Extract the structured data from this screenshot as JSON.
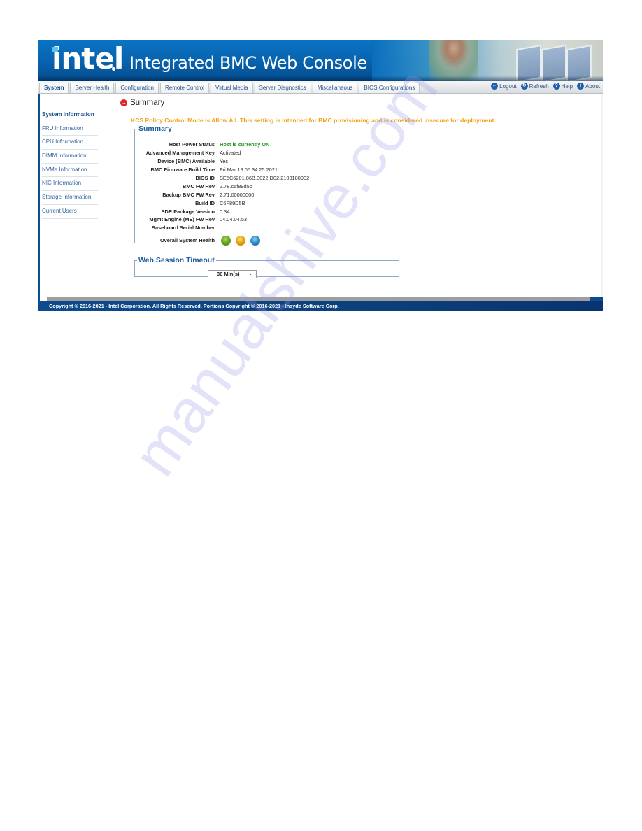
{
  "header": {
    "logo_text": "intel",
    "app_title": "Integrated BMC Web Console"
  },
  "tabs": [
    {
      "label": "System",
      "active": true
    },
    {
      "label": "Server Health",
      "active": false
    },
    {
      "label": "Configuration",
      "active": false
    },
    {
      "label": "Remote Control",
      "active": false
    },
    {
      "label": "Virtual Media",
      "active": false
    },
    {
      "label": "Server Diagnostics",
      "active": false
    },
    {
      "label": "Miscellaneous",
      "active": false
    },
    {
      "label": "BIOS Configurations",
      "active": false
    }
  ],
  "toolbar": {
    "logout": {
      "label": "Logout",
      "icon": "logout-icon",
      "glyph": "←"
    },
    "refresh": {
      "label": "Refresh",
      "icon": "refresh-icon",
      "glyph": "↻"
    },
    "help": {
      "label": "Help",
      "icon": "help-icon",
      "glyph": "?"
    },
    "about": {
      "label": "About",
      "icon": "info-icon",
      "glyph": "i"
    }
  },
  "sidebar": {
    "items": [
      {
        "label": "System Information",
        "active": true
      },
      {
        "label": "FRU Information",
        "active": false
      },
      {
        "label": "CPU Information",
        "active": false
      },
      {
        "label": "DIMM Information",
        "active": false
      },
      {
        "label": "NVMe Information",
        "active": false
      },
      {
        "label": "NIC Information",
        "active": false
      },
      {
        "label": "Storage Information",
        "active": false
      },
      {
        "label": "Current Users",
        "active": false
      }
    ]
  },
  "main": {
    "page_title": "Summary",
    "page_icon_glyph": "→",
    "warning": "KCS Policy Control Mode is Allow All. This setting is intended for BMC provisioning and is considered insecure for deployment.",
    "warning_color": "#f2a21a",
    "summary": {
      "legend": "Summary",
      "separator": ":",
      "rows": [
        {
          "label": "Host Power Status",
          "value": "Host is currently ON"
        },
        {
          "label": "Advanced Management Key",
          "value": "Activated"
        },
        {
          "label": "Device (BMC) Available",
          "value": "Yes"
        },
        {
          "label": "BMC Firmware Build Time",
          "value": "Fri Mar 19 05:34:25 2021"
        },
        {
          "label": "BIOS ID",
          "value": "SE5C6201.86B.0022.D02.2103180902"
        },
        {
          "label": "BMC FW Rev",
          "value": "2.78.c6f89d5b"
        },
        {
          "label": "Backup BMC FW Rev",
          "value": "2.71.00000000"
        },
        {
          "label": "Build ID",
          "value": "C6F89D5B"
        },
        {
          "label": "SDR Package Version",
          "value": "0.34"
        },
        {
          "label": "Mgmt Engine (ME) FW Rev",
          "value": "04.04.04.53"
        },
        {
          "label": "Baseboard Serial Number",
          "value": "............"
        }
      ],
      "health_label": "Overall System Health",
      "health_indicators": [
        {
          "name": "green",
          "color": "#6aa520"
        },
        {
          "name": "amber",
          "color": "#e6a50f"
        },
        {
          "name": "blue",
          "color": "#2f8fcd"
        }
      ],
      "power_on_color": "#1f9a1f"
    },
    "session_timeout": {
      "legend": "Web Session Timeout",
      "selected": "30 Min(s)"
    }
  },
  "footer": {
    "copyright": "Copyright © 2016-2021 - Intel Corporation. All Rights Reserved. Portions Copyright © 2016-2021 - Insyde Software Corp."
  },
  "watermark": "manualshive.com"
}
